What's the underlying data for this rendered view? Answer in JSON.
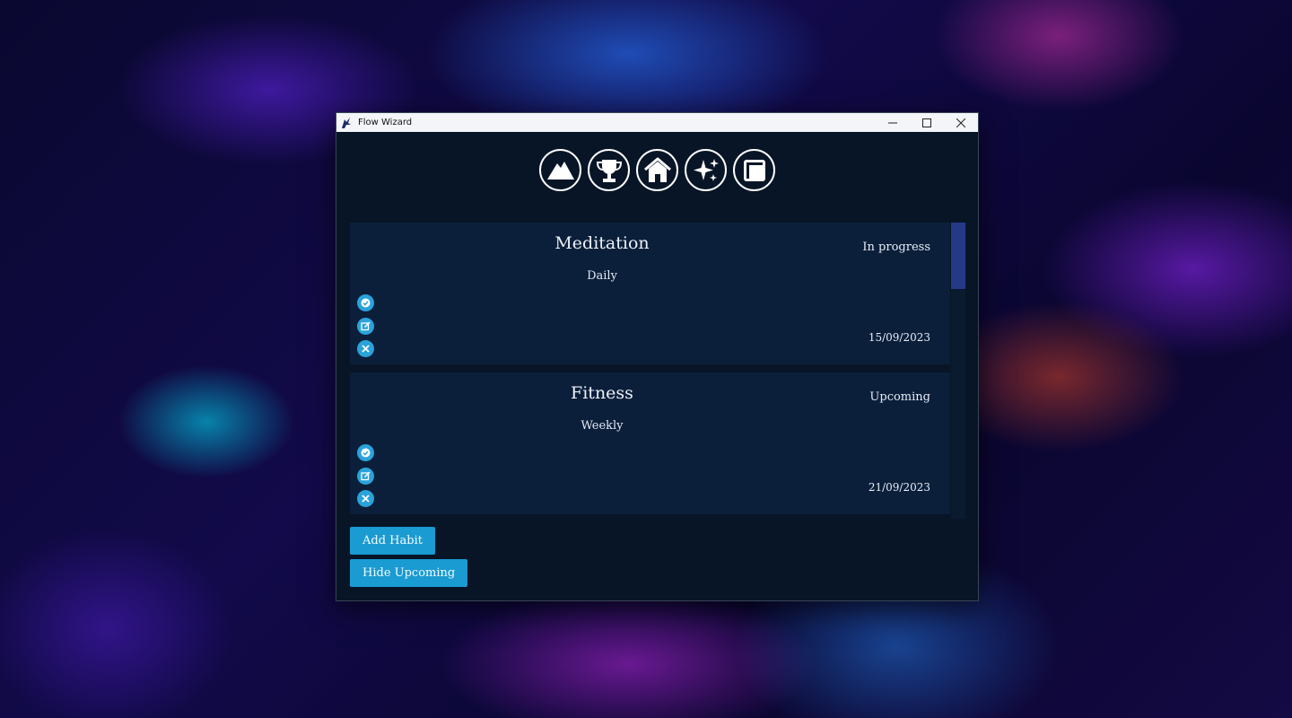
{
  "window": {
    "title": "Flow Wizard"
  },
  "nav": [
    {
      "icon": "mountain-icon"
    },
    {
      "icon": "trophy-icon"
    },
    {
      "icon": "home-icon"
    },
    {
      "icon": "sparkle-icon"
    },
    {
      "icon": "window-icon"
    }
  ],
  "habits": [
    {
      "title": "Meditation",
      "frequency": "Daily",
      "status": "In progress",
      "date": "15/09/2023"
    },
    {
      "title": "Fitness",
      "frequency": "Weekly",
      "status": "Upcoming",
      "date": "21/09/2023"
    }
  ],
  "buttons": {
    "add_habit": "Add Habit",
    "hide_upcoming": "Hide Upcoming"
  },
  "colors": {
    "accent": "#1a9bd1",
    "card_bg": "#0b1f3b",
    "window_bg": "#081527",
    "scrollbar": "#243a86"
  }
}
